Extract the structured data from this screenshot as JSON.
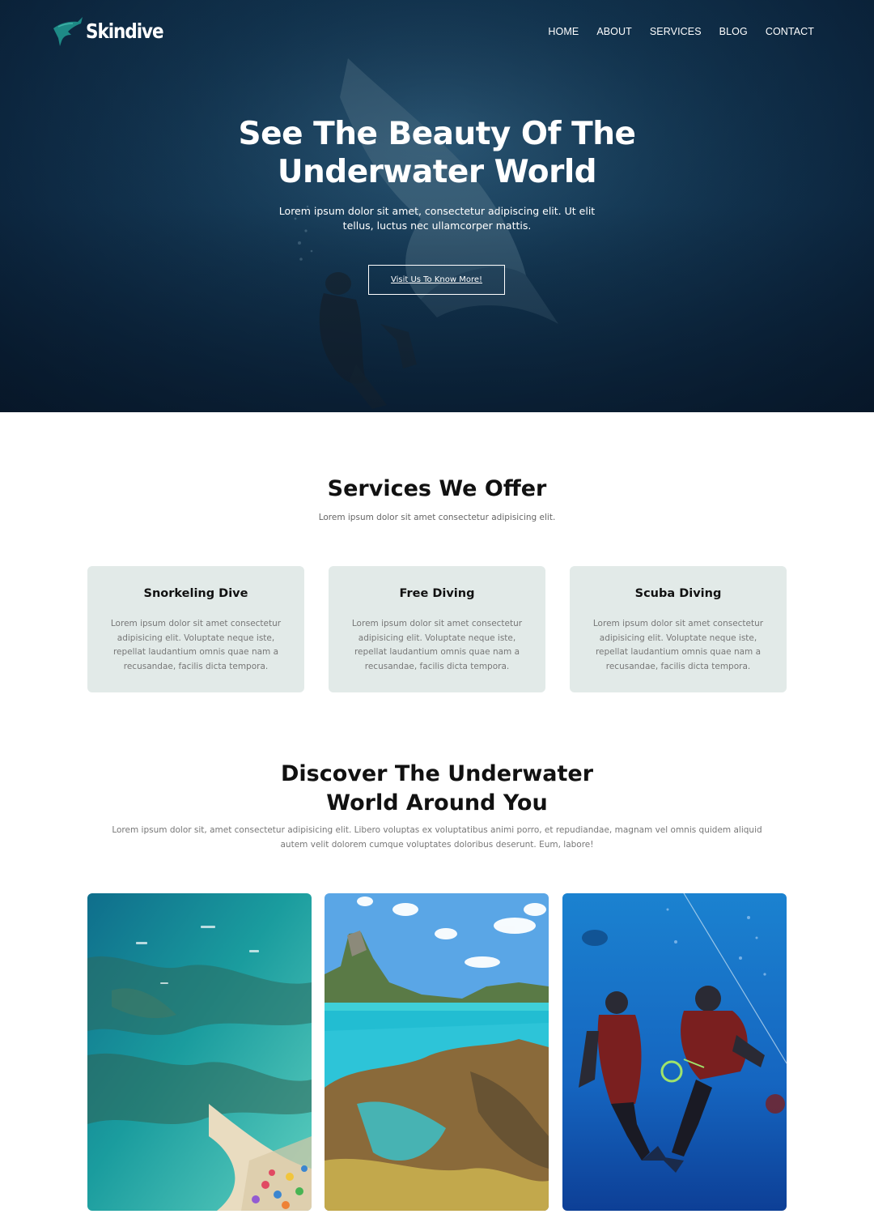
{
  "brand": {
    "name": "Skindive",
    "accent": "#1e8a86"
  },
  "nav": {
    "items": [
      {
        "label": "HOME",
        "name": "nav-home"
      },
      {
        "label": "ABOUT",
        "name": "nav-about"
      },
      {
        "label": "SERVICES",
        "name": "nav-services"
      },
      {
        "label": "BLOG",
        "name": "nav-blog"
      },
      {
        "label": "CONTACT",
        "name": "nav-contact"
      }
    ]
  },
  "hero": {
    "title_line1": "See The Beauty Of The",
    "title_line2": "Underwater World",
    "subtitle_line1": "Lorem ipsum dolor sit amet, consectetur adipiscing elit. Ut elit",
    "subtitle_line2": "tellus, luctus nec ullamcorper mattis.",
    "cta": "Visit Us To Know More!"
  },
  "services": {
    "title": "Services We Offer",
    "subtitle": "Lorem ipsum dolor sit amet consectetur adipisicing elit.",
    "cards": [
      {
        "title": "Snorkeling Dive",
        "text": "Lorem ipsum dolor sit amet consectetur adipisicing elit. Voluptate neque iste, repellat laudantium omnis quae nam a recusandae, facilis dicta tempora."
      },
      {
        "title": "Free Diving",
        "text": "Lorem ipsum dolor sit amet consectetur adipisicing elit. Voluptate neque iste, repellat laudantium omnis quae nam a recusandae, facilis dicta tempora."
      },
      {
        "title": "Scuba Diving",
        "text": "Lorem ipsum dolor sit amet consectetur adipisicing elit. Voluptate neque iste, repellat laudantium omnis quae nam a recusandae, facilis dicta tempora."
      }
    ]
  },
  "discover": {
    "title_line1": "Discover The Underwater",
    "title_line2": "World Around You",
    "text_line1": "Lorem ipsum dolor sit, amet consectetur adipisicing elit. Libero voluptas ex voluptatibus animi porro, et repudiandae, magnam vel omnis quidem aliquid",
    "text_line2": "autem velit dolorem cumque voluptates doloribus deserunt. Eum, labore!"
  },
  "gallery": [
    {
      "name": "aerial-reef-photo"
    },
    {
      "name": "island-coast-photo"
    },
    {
      "name": "scuba-divers-photo"
    }
  ]
}
